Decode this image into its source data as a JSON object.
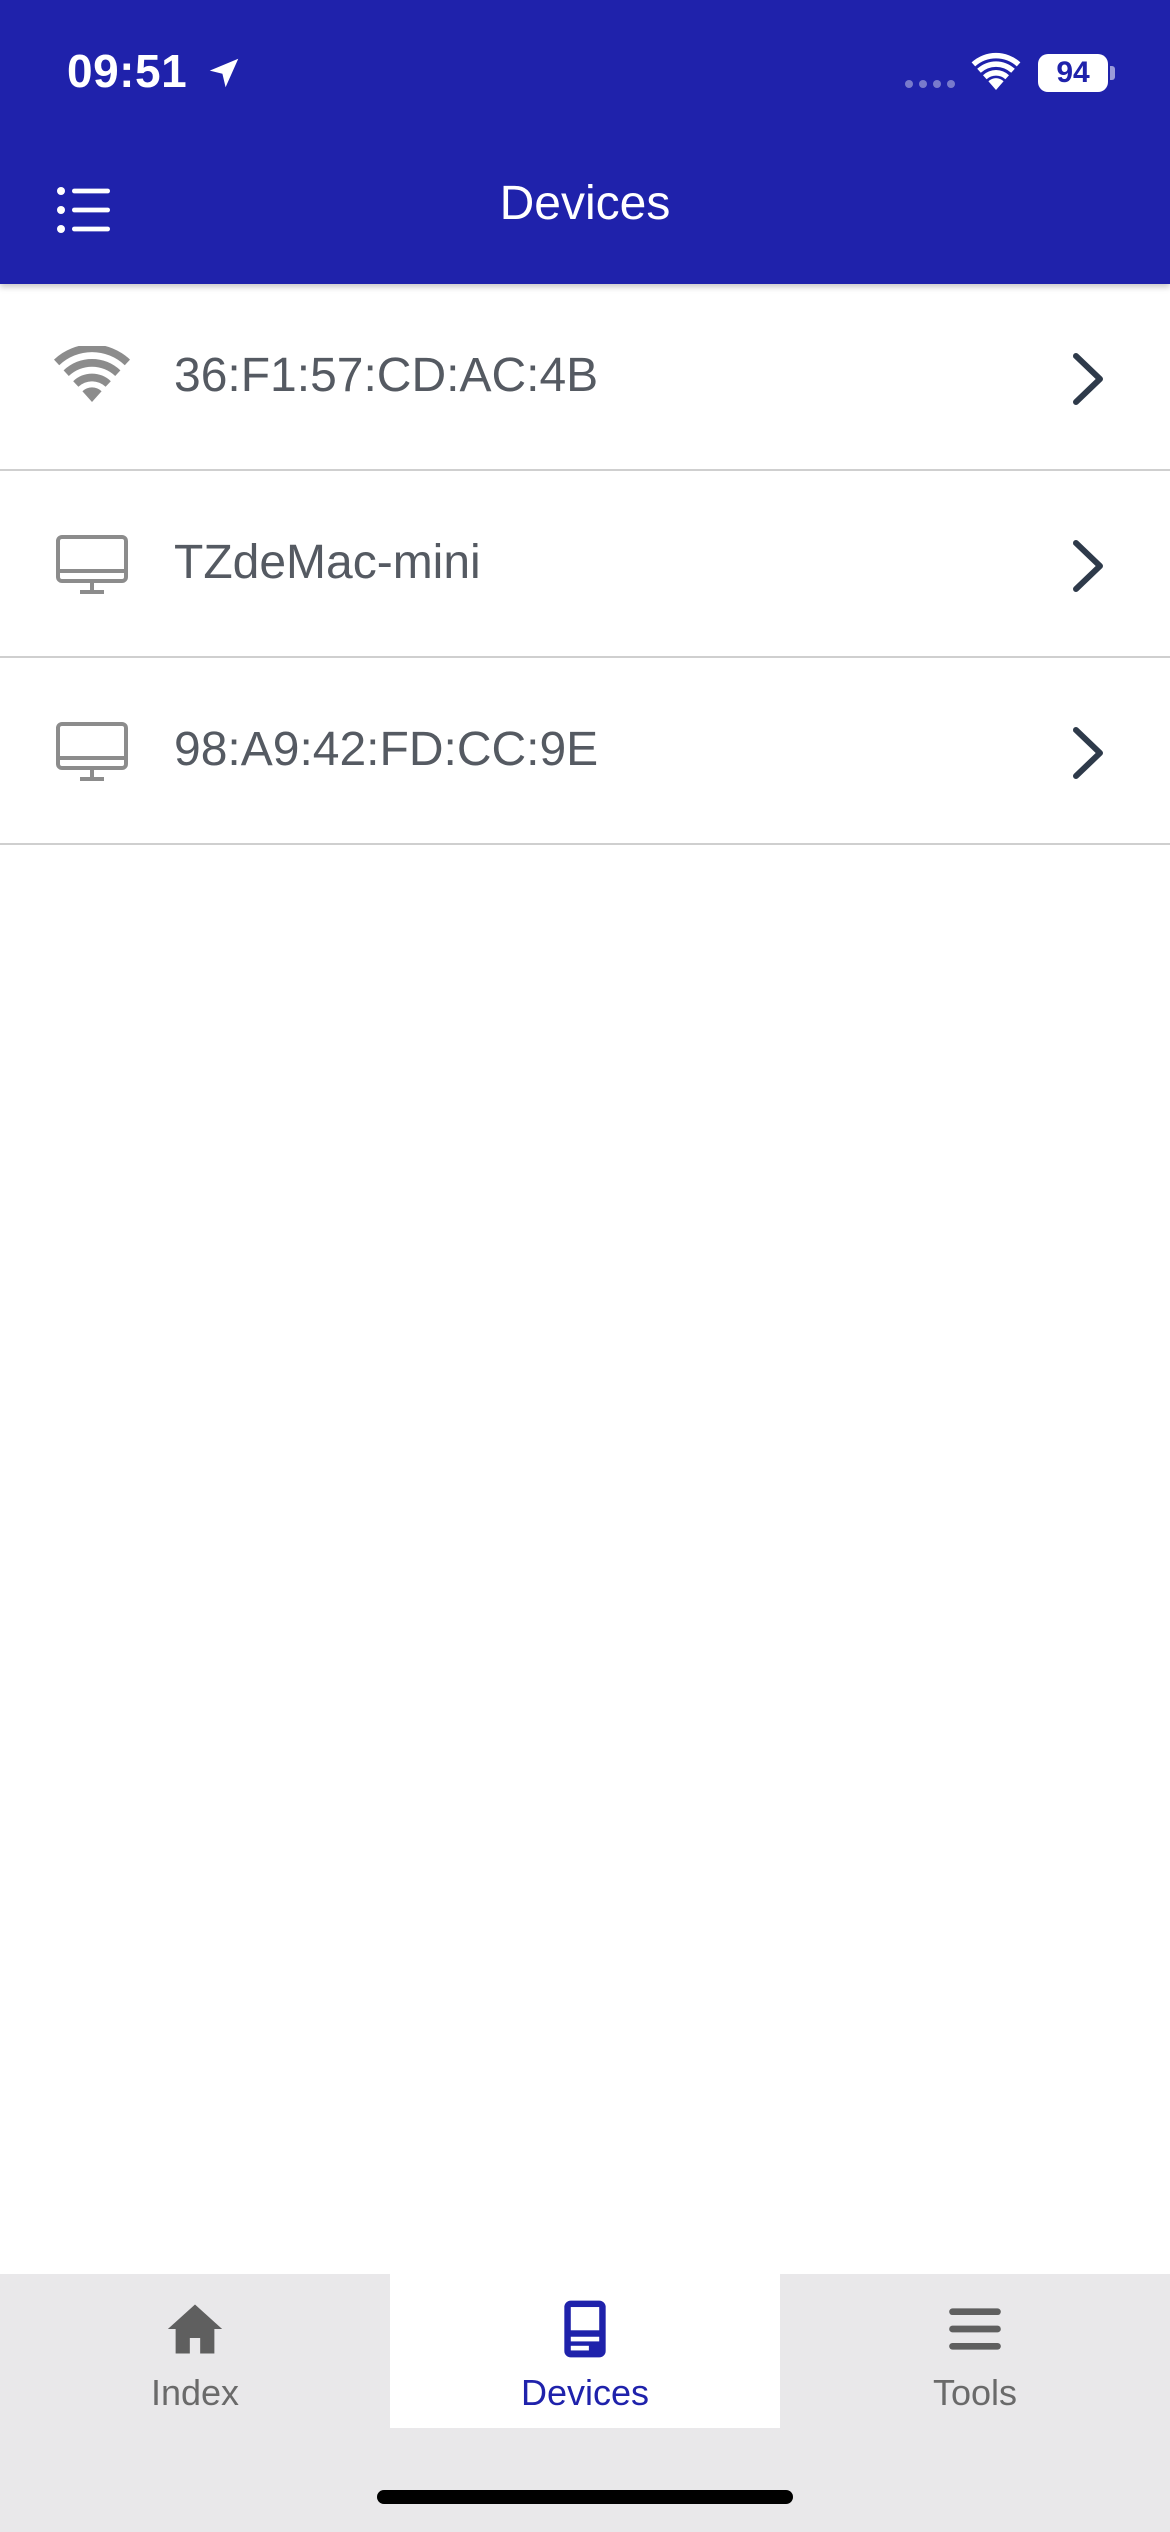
{
  "status_bar": {
    "time": "09:51",
    "battery": "94"
  },
  "nav": {
    "title": "Devices",
    "menu_icon": "list-menu-icon"
  },
  "devices": [
    {
      "name": "36:F1:57:CD:AC:4B",
      "icon": "wifi-icon"
    },
    {
      "name": "TZdeMac-mini",
      "icon": "monitor-icon"
    },
    {
      "name": "98:A9:42:FD:CC:9E",
      "icon": "monitor-icon"
    }
  ],
  "tabs": [
    {
      "label": "Index",
      "icon": "home-icon",
      "active": false
    },
    {
      "label": "Devices",
      "icon": "device-icon",
      "active": true
    },
    {
      "label": "Tools",
      "icon": "menu-lines-icon",
      "active": false
    }
  ],
  "colors": {
    "accent": "#1f22ab",
    "icon_gray": "#8c8c8c",
    "chevron": "#2e3a4a",
    "tabbar_bg": "#e9e8ea"
  }
}
